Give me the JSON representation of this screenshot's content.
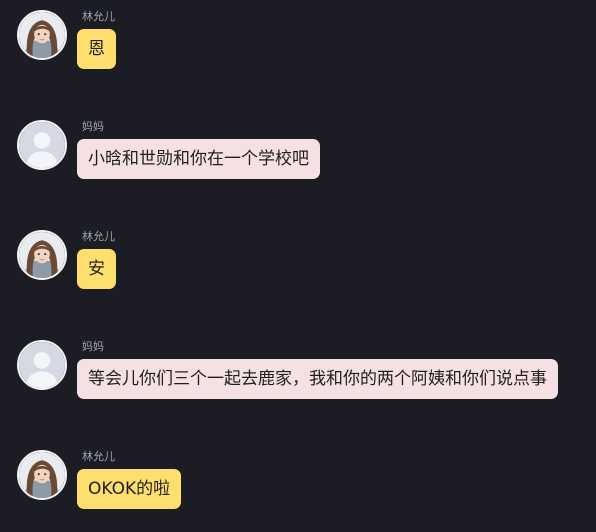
{
  "colors": {
    "background": "#1b1c24",
    "bubble_self": "#fedf6d",
    "bubble_other": "#f5e0e3",
    "name_text": "#a3a5ac"
  },
  "messages": [
    {
      "sender": "林允儿",
      "text": "恩",
      "avatar": "girl-photo-icon",
      "bubble": "yellow"
    },
    {
      "sender": "妈妈",
      "text": "小晗和世勋和你在一个学校吧",
      "avatar": "default-user-icon",
      "bubble": "pink"
    },
    {
      "sender": "林允儿",
      "text": "安",
      "avatar": "girl-photo-icon",
      "bubble": "yellow"
    },
    {
      "sender": "妈妈",
      "text": "等会儿你们三个一起去鹿家，我和你的两个阿姨和你们说点事",
      "avatar": "default-user-icon",
      "bubble": "pink"
    },
    {
      "sender": "林允儿",
      "text": "OKOK的啦",
      "avatar": "girl-photo-icon",
      "bubble": "yellow"
    }
  ]
}
